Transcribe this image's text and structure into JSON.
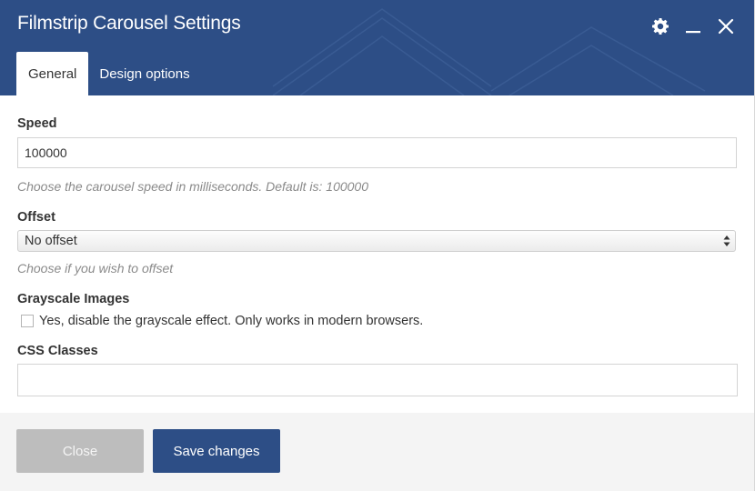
{
  "dialog": {
    "title": "Filmstrip Carousel Settings",
    "controls": [
      "gear-icon",
      "minimize-icon",
      "close-icon"
    ],
    "tabs": [
      {
        "label": "General",
        "active": true
      },
      {
        "label": "Design options",
        "active": false
      }
    ]
  },
  "fields": {
    "speed": {
      "label": "Speed",
      "value": "100000",
      "hint": "Choose the carousel speed in milliseconds. Default is: 100000"
    },
    "offset": {
      "label": "Offset",
      "selected": "No offset",
      "hint": "Choose if you wish to offset"
    },
    "grayscale": {
      "label": "Grayscale Images",
      "checkbox_label": "Yes, disable the grayscale effect. Only works in modern browsers.",
      "checked": false
    },
    "css_classes": {
      "label": "CSS Classes",
      "value": ""
    }
  },
  "footer": {
    "close_label": "Close",
    "save_label": "Save changes"
  },
  "colors": {
    "brand": "#2d4e86",
    "close_button": "#bdbdbd",
    "footer_bg": "#f4f4f4"
  }
}
